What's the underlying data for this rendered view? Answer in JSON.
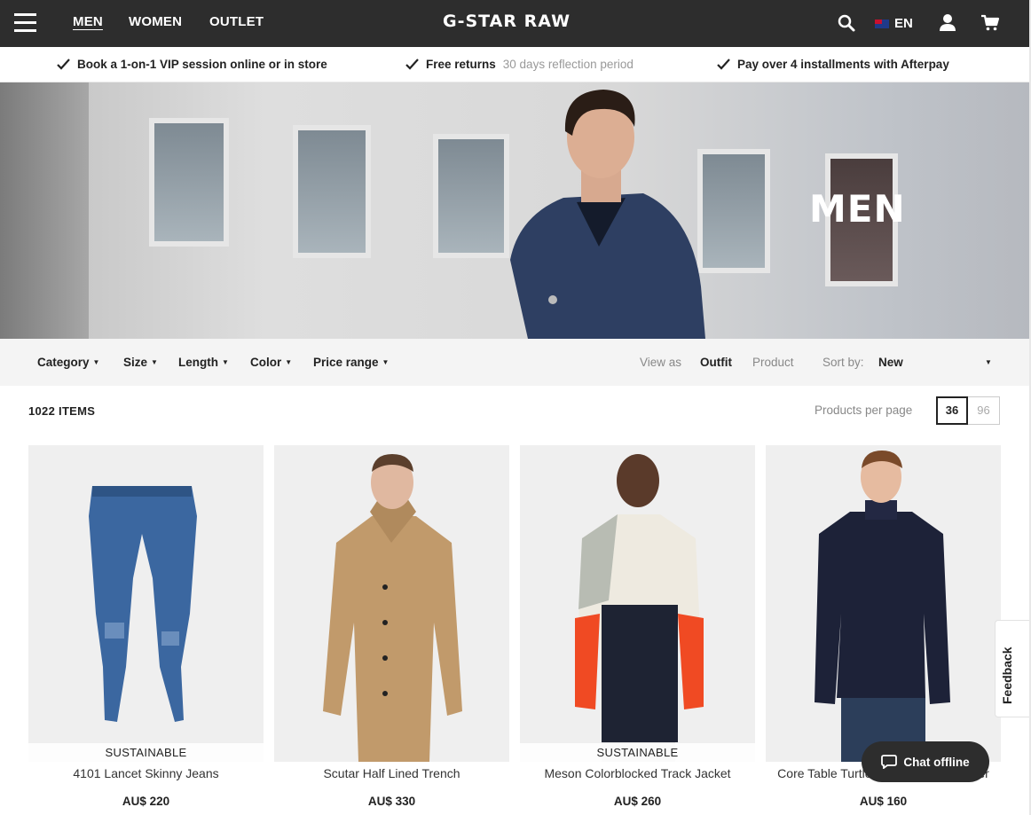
{
  "nav": {
    "links": [
      "MEN",
      "WOMEN",
      "OUTLET"
    ],
    "logo": "G-STAR RAW",
    "language": "EN",
    "icons": [
      "menu-icon",
      "search-icon",
      "flag-icon",
      "user-icon",
      "cart-icon"
    ]
  },
  "usps": [
    {
      "bold": "Book a 1-on-1 VIP session online or in store",
      "muted": ""
    },
    {
      "bold": "Free returns",
      "muted": "30 days reflection period"
    },
    {
      "bold": "Pay over 4 installments with Afterpay",
      "muted": ""
    }
  ],
  "hero": {
    "title": "MEN"
  },
  "filters": {
    "items": [
      "Category",
      "Size",
      "Length",
      "Color",
      "Price range"
    ],
    "view_as_label": "View as",
    "view_outfit": "Outfit",
    "view_product": "Product",
    "sort_label": "Sort by:",
    "sort_value": "New"
  },
  "listing": {
    "count": "1022 ITEMS",
    "per_page_label": "Products per page",
    "per_page_options": [
      "36",
      "96"
    ],
    "per_page_selected": "36"
  },
  "products": [
    {
      "name": "4101 Lancet Skinny Jeans",
      "price": "AU$ 220",
      "badge": "SUSTAINABLE"
    },
    {
      "name": "Scutar Half Lined Trench",
      "price": "AU$ 330",
      "badge": ""
    },
    {
      "name": "Meson Colorblocked Track Jacket",
      "price": "AU$ 260",
      "badge": "SUSTAINABLE"
    },
    {
      "name": "Core Table Turtleneck Knitted Sweater",
      "price": "AU$ 160",
      "badge": ""
    }
  ],
  "widgets": {
    "feedback": "Feedback",
    "chat": "Chat offline"
  },
  "colors": {
    "nav_bg": "#2d2d2d",
    "filter_bg": "#f4f4f4",
    "card_bg": "#efefef"
  }
}
